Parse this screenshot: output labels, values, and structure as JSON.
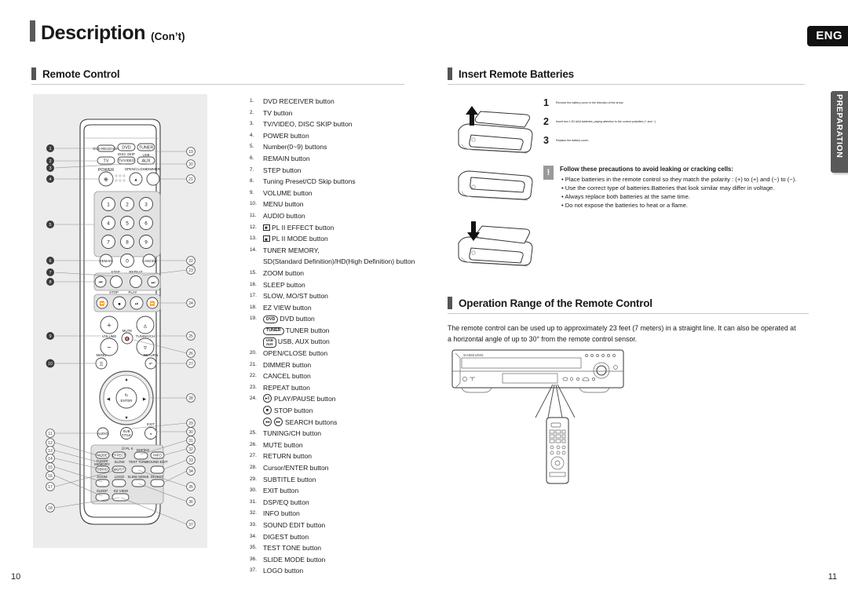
{
  "page": {
    "title_main": "Description",
    "title_sub": "(Con’t)",
    "lang_badge": "ENG",
    "side_tab": "PREPARATION",
    "page_number_left": "10",
    "page_number_right": "11"
  },
  "sections": {
    "remote_control": {
      "title": "Remote Control"
    },
    "insert_batteries": {
      "title": "Insert Remote Batteries"
    },
    "operation_range": {
      "title": "Operation Range of the Remote Control",
      "body": "The remote control can be used up to approximately 23 feet (7 meters) in a straight line. It can also be operated at a horizontal angle of up to 30° from the remote control sensor."
    }
  },
  "remote_legend": [
    {
      "num": "1.",
      "text": "DVD RECEIVER button"
    },
    {
      "num": "2.",
      "text": "TV button"
    },
    {
      "num": "3.",
      "text": "TV/VIDEO, DISC SKIP button"
    },
    {
      "num": "4.",
      "text": "POWER button"
    },
    {
      "num": "5.",
      "text": "Number(0~9) buttons"
    },
    {
      "num": "6.",
      "text": "REMAIN button"
    },
    {
      "num": "7.",
      "text": "STEP button"
    },
    {
      "num": "8.",
      "text": "Tuning Preset/CD Skip buttons"
    },
    {
      "num": "9.",
      "text": "VOLUME button"
    },
    {
      "num": "10.",
      "text": "MENU button"
    },
    {
      "num": "11.",
      "text": "AUDIO button"
    },
    {
      "num": "12.",
      "text": "PL II EFFECT button",
      "icon": "dolby-pl2-icon"
    },
    {
      "num": "13.",
      "text": "PL II MODE button",
      "icon": "dolby-pl2-icon"
    },
    {
      "num": "14.",
      "text": "TUNER MEMORY,"
    },
    {
      "num": "",
      "text": "SD(Standard Definition)/HD(High Definition) button",
      "indent": true
    },
    {
      "num": "15.",
      "text": "ZOOM button"
    },
    {
      "num": "16.",
      "text": "SLEEP button"
    },
    {
      "num": "17.",
      "text": "SLOW, MO/ST button"
    },
    {
      "num": "18.",
      "text": "EZ VIEW button"
    },
    {
      "num": "19.",
      "text": "DVD button",
      "chip": "DVD"
    },
    {
      "num": "",
      "text": "TUNER button",
      "chip": "TUNER",
      "indent": true
    },
    {
      "num": "",
      "text": "USB, AUX button",
      "chip2_top": "USB",
      "chip2_bottom": "AUX",
      "indent": true
    },
    {
      "num": "20.",
      "text": "OPEN/CLOSE button"
    },
    {
      "num": "21.",
      "text": "DIMMER button"
    },
    {
      "num": "22.",
      "text": "CANCEL button"
    },
    {
      "num": "23.",
      "text": "REPEAT button"
    },
    {
      "num": "24.",
      "text": "PLAY/PAUSE button",
      "round": "play-pause"
    },
    {
      "num": "",
      "text": "STOP button",
      "round": "stop",
      "indent": true
    },
    {
      "num": "",
      "text": "SEARCH buttons",
      "round": "search",
      "indent": true
    },
    {
      "num": "25.",
      "text": "TUNING/CH button"
    },
    {
      "num": "26.",
      "text": "MUTE button"
    },
    {
      "num": "27.",
      "text": "RETURN button"
    },
    {
      "num": "28.",
      "text": "Cursor/ENTER button"
    },
    {
      "num": "29.",
      "text": "SUBTITLE button"
    },
    {
      "num": "30.",
      "text": "EXIT button"
    },
    {
      "num": "31.",
      "text": "DSP/EQ button"
    },
    {
      "num": "32.",
      "text": "INFO button"
    },
    {
      "num": "33.",
      "text": "SOUND EDIT button"
    },
    {
      "num": "34.",
      "text": "DIGEST button"
    },
    {
      "num": "35.",
      "text": "TEST TONE button"
    },
    {
      "num": "36.",
      "text": "SLIDE MODE button"
    },
    {
      "num": "37.",
      "text": "LOGO button"
    }
  ],
  "remote_diagram": {
    "labels": {
      "dvd_receiver": "DVD RECEIVER",
      "dvd": "DVD",
      "tuner": "TUNER",
      "tv": "TV",
      "tv_video": "TV/VIDEO",
      "disc_skip": "DISC SKIP",
      "usb": "USB",
      "aux": "AUX",
      "power": "POWER",
      "open_close": "OPEN/CLOSE",
      "dimmer": "DIMMER",
      "remain": "REMAIN",
      "cancel": "CANCEL",
      "step": "STEP",
      "repeat": "REPEAT",
      "stop": "STOP",
      "play": "PLAY",
      "volume": "VOLUME",
      "mute": "MUTE",
      "tuning_ch": "TUNING/CH",
      "menu": "MENU",
      "return": "RETURN",
      "enter": "ENTER",
      "audio": "AUDIO",
      "subtitle": "SUBTITLE",
      "exit": "EXIT",
      "pl2": "PL II",
      "mode": "MODE",
      "effect": "EFFECT",
      "dsp_eq": "DSP/EQ",
      "info": "INFO",
      "tuner_memory": "TUNER MEMORY",
      "slow": "SLOW",
      "test_tone": "TEST TONE",
      "sound_edit": "SOUND EDIT",
      "sd_hd": "SD/HD",
      "mo_st": "MO/ST",
      "zoom": "ZOOM",
      "logo": "LOGO",
      "slide_mode": "SLIDE MODE",
      "digest": "DIGEST",
      "sleep": "SLEEP",
      "ez_view": "EZ VIEW"
    },
    "keypad": [
      "1",
      "2",
      "3",
      "4",
      "5",
      "6",
      "7",
      "8",
      "9",
      "0"
    ],
    "callouts_left": [
      "1",
      "2",
      "3",
      "4",
      "5",
      "6",
      "7",
      "8",
      "9",
      "10",
      "11",
      "12",
      "13",
      "14",
      "15",
      "16",
      "17",
      "18"
    ],
    "callouts_right": [
      "19",
      "20",
      "21",
      "22",
      "23",
      "24",
      "25",
      "26",
      "27",
      "28",
      "29",
      "30",
      "31",
      "32",
      "33",
      "34",
      "35",
      "36",
      "37"
    ]
  },
  "battery_steps": [
    {
      "n": "1",
      "text": "Remove the battery cover in the direction of the arrow."
    },
    {
      "n": "2",
      "text": "Insert two 1.5V AAA batteries, paying attention to the correct polarities (+ and −)."
    },
    {
      "n": "3",
      "text": "Replace the battery cover."
    }
  ],
  "caution": {
    "icon": "exclamation-icon",
    "heading": "Follow these precautions to avoid leaking or cracking cells:",
    "bullets": [
      "• Place batteries in the remote control so they match the polarity : (+) to (+) and (−) to (−).",
      "• Use the correct type of batteries.Batteries that look similar may differ in voltage.",
      "• Always replace both batteries at the same time.",
      "• Do not expose the batteries to heat or a flame."
    ]
  },
  "player_unit": {
    "brand": "SAMSUNG"
  },
  "colors": {
    "accent_bar": "#555555",
    "panel_bg": "#ececec",
    "tab_bg": "#595959",
    "badge_bg": "#111111",
    "rule": "#c9c9c9"
  }
}
